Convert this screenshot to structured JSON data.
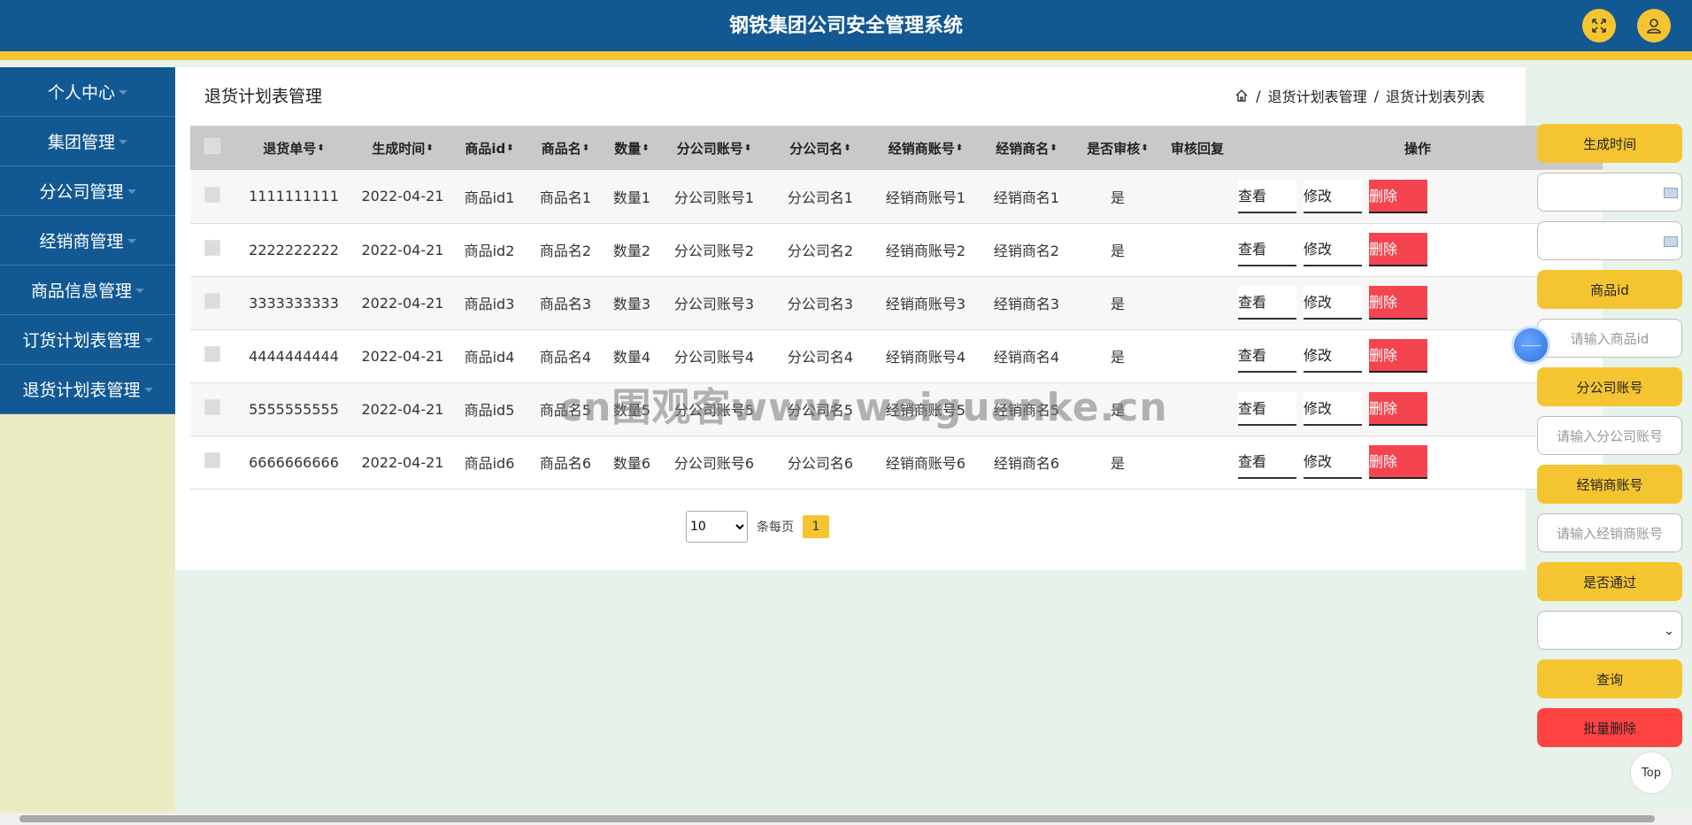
{
  "header": {
    "title": "钢铁集团公司安全管理系统",
    "fullscreen_icon": "expand-icon",
    "user_icon": "user-icon"
  },
  "sidebar": {
    "items": [
      {
        "label": "个人中心"
      },
      {
        "label": "集团管理"
      },
      {
        "label": "分公司管理"
      },
      {
        "label": "经销商管理"
      },
      {
        "label": "商品信息管理"
      },
      {
        "label": "订货计划表管理"
      },
      {
        "label": "退货计划表管理"
      }
    ]
  },
  "main": {
    "page_title": "退货计划表管理",
    "breadcrumb": {
      "sep": "/",
      "items": [
        "退货计划表管理",
        "退货计划表列表"
      ]
    },
    "table": {
      "columns": [
        "退货单号",
        "生成时间",
        "商品id",
        "商品名",
        "数量",
        "分公司账号",
        "分公司名",
        "经销商账号",
        "经销商名",
        "是否审核",
        "审核回复",
        "操作"
      ],
      "rows": [
        [
          "1111111111",
          "2022-04-21",
          "商品id1",
          "商品名1",
          "数量1",
          "分公司账号1",
          "分公司名1",
          "经销商账号1",
          "经销商名1",
          "是",
          ""
        ],
        [
          "2222222222",
          "2022-04-21",
          "商品id2",
          "商品名2",
          "数量2",
          "分公司账号2",
          "分公司名2",
          "经销商账号2",
          "经销商名2",
          "是",
          ""
        ],
        [
          "3333333333",
          "2022-04-21",
          "商品id3",
          "商品名3",
          "数量3",
          "分公司账号3",
          "分公司名3",
          "经销商账号3",
          "经销商名3",
          "是",
          ""
        ],
        [
          "4444444444",
          "2022-04-21",
          "商品id4",
          "商品名4",
          "数量4",
          "分公司账号4",
          "分公司名4",
          "经销商账号4",
          "经销商名4",
          "是",
          ""
        ],
        [
          "5555555555",
          "2022-04-21",
          "商品id5",
          "商品名5",
          "数量5",
          "分公司账号5",
          "分公司名5",
          "经销商账号5",
          "经销商名5",
          "是",
          ""
        ],
        [
          "6666666666",
          "2022-04-21",
          "商品id6",
          "商品名6",
          "数量6",
          "分公司账号6",
          "分公司名6",
          "经销商账号6",
          "经销商名6",
          "是",
          ""
        ]
      ],
      "actions": {
        "view": "查看",
        "edit": "修改",
        "delete": "删除"
      }
    },
    "pagination": {
      "page_size": "10",
      "page_size_label": "条每页",
      "current_page": "1"
    }
  },
  "filters": {
    "time_label": "生成时间",
    "goods_id_label": "商品id",
    "goods_id_placeholder": "请输入商品id",
    "branch_account_label": "分公司账号",
    "branch_account_placeholder": "请输入分公司账号",
    "dealer_account_label": "经销商账号",
    "dealer_account_placeholder": "请输入经销商账号",
    "approved_label": "是否通过",
    "search_button": "查询",
    "batch_delete_button": "批量删除"
  },
  "top_button": "Top",
  "watermark": "cn围观客www.weiguanke.cn",
  "colors": {
    "header_bg": "#125994",
    "accent": "#f5c531",
    "danger": "#f4444f",
    "sidebar_bg": "#ececc3",
    "page_bg": "#e6f2ea"
  }
}
